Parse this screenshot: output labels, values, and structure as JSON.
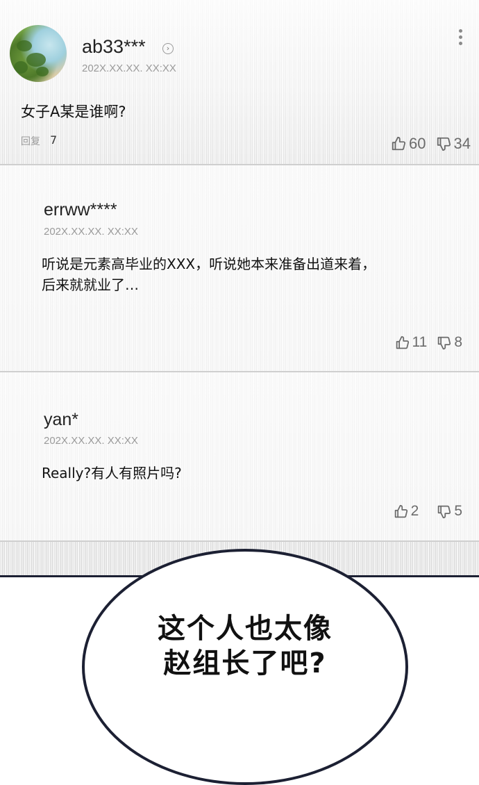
{
  "main_comment": {
    "username": "ab33***",
    "date": "202X.XX.XX. XX:XX",
    "text": "女子A某是谁啊?",
    "reply_label": "回复",
    "reply_count": "7",
    "likes": "60",
    "dislikes": "34"
  },
  "replies": [
    {
      "username": "errww****",
      "date": "202X.XX.XX. XX:XX",
      "text_line1": "听说是元素高毕业的XXX，听说她本来准备出道来着，",
      "text_line2": "后来就就业了…",
      "likes": "11",
      "dislikes": "8"
    },
    {
      "username": "yan*",
      "date": "202X.XX.XX. XX:XX",
      "text_line1": "Really?有人有照片吗?",
      "likes": "2",
      "dislikes": "5"
    }
  ],
  "speech_bubble": {
    "line1": "这个人也太像",
    "line2": "赵组长了吧?"
  },
  "icons": {
    "like": "thumbs-up-icon",
    "dislike": "thumbs-down-icon",
    "more": "more-vertical-icon",
    "profile_link": "chevron-right-circle-icon"
  }
}
